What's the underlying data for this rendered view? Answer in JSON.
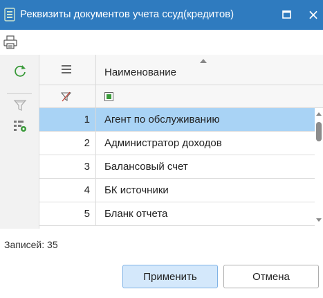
{
  "window": {
    "title": "Реквизиты документов учета ссуд(кредитов)",
    "accent_color": "#2f7bbf",
    "icons": {
      "app": "document-icon",
      "maximize": "maximize-icon",
      "close": "close-icon",
      "close_glyph": "×"
    }
  },
  "toolbar": {
    "print_icon": "printer-icon"
  },
  "left_panel": {
    "icons": [
      "refresh-icon",
      "filter-clear-icon",
      "column-settings-icon"
    ]
  },
  "grid": {
    "header": {
      "num_icon": "menu-icon",
      "name_label": "Наименование",
      "sort": "ascending"
    },
    "filter_row": {
      "num_icon": "filter-off-icon",
      "name_filter": "checkbox"
    },
    "rows": [
      {
        "num": "1",
        "name": "Агент по обслуживанию",
        "selected": true
      },
      {
        "num": "2",
        "name": "Администратор доходов",
        "selected": false
      },
      {
        "num": "3",
        "name": "Балансовый счет",
        "selected": false
      },
      {
        "num": "4",
        "name": "БК источники",
        "selected": false
      },
      {
        "num": "5",
        "name": "Бланк отчета",
        "selected": false
      }
    ],
    "selected_color": "#a9d3f5"
  },
  "status": {
    "records_text": "Записей: 35"
  },
  "buttons": {
    "apply_label": "Применить",
    "cancel_label": "Отмена"
  }
}
